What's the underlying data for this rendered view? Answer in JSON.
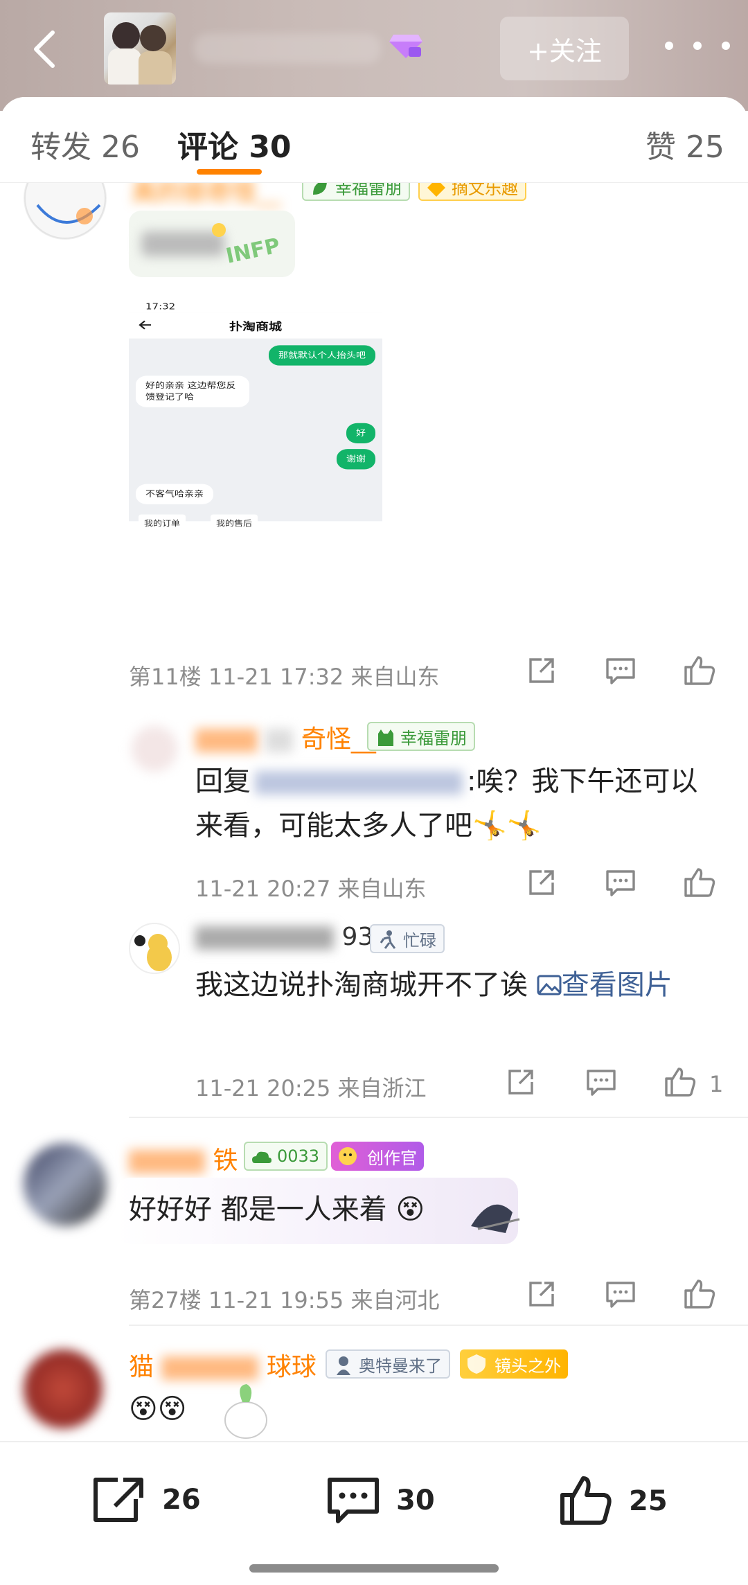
{
  "header": {
    "follow_label": "+关注"
  },
  "tabs": [
    {
      "label": "转发 26"
    },
    {
      "label": "评论 30"
    },
    {
      "label": "赞 25"
    }
  ],
  "embedded_screenshot": {
    "time": "17:32",
    "title": "扑淘商城",
    "messages": [
      {
        "side": "right",
        "text": "那就默认个人抬头吧"
      },
      {
        "side": "left",
        "text": "好的亲亲 这边帮您反馈登记了哈"
      },
      {
        "side": "right",
        "text": "好"
      },
      {
        "side": "right",
        "text": "谢谢"
      },
      {
        "side": "left",
        "text": "不客气哈亲亲"
      }
    ],
    "chips": [
      "我的订单",
      "我的售后"
    ]
  },
  "comments": {
    "c1": {
      "name_partial": "真的很奇怪__",
      "badge1": "幸福雷朋",
      "badge2": "摘文乐趣",
      "meta": "第11楼 11-21 17:32 来自山东"
    },
    "r1": {
      "name_partial": "奇怪__",
      "badge": "幸福雷朋",
      "text_prefix": "回复",
      "text_suffix": ":唉？我下午还可以来看，可能太多人了吧",
      "meta": "11-21 20:27 来自山东"
    },
    "r2": {
      "name_partial": "93",
      "badge": "忙碌",
      "text": "我这边说扑淘商城开不了诶",
      "link": "查看图片",
      "meta": "11-21 20:25 来自浙江",
      "likes": "1"
    },
    "c2": {
      "name_partial": "铁",
      "badge1": "0033",
      "badge2": "创作官",
      "text": "好好好 都是一人来着",
      "meta": "第27楼 11-21 19:55 来自河北"
    },
    "c3": {
      "name_partial_a": "猫",
      "name_partial_b": "球球",
      "badge1": "奥特曼来了",
      "badge2": "镜头之外"
    }
  },
  "bottom_bar": {
    "repost_count": "26",
    "comment_count": "30",
    "like_count": "25"
  },
  "colors": {
    "accent": "#ff8200",
    "link": "#3f6196",
    "meta": "#8c8c8c"
  }
}
